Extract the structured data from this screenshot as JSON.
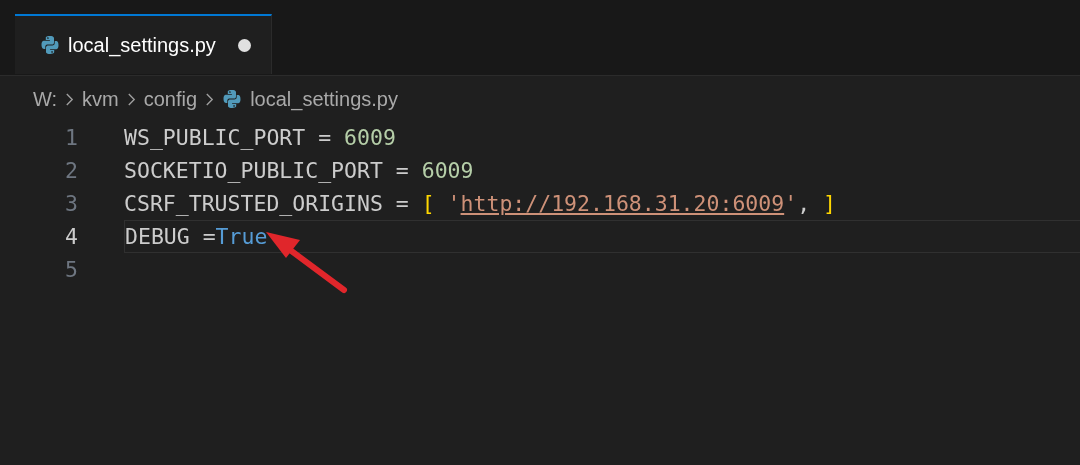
{
  "tabs": [
    {
      "label": "local_settings.py",
      "selected": true,
      "modified": true
    }
  ],
  "breadcrumb": [
    "W:",
    "kvm",
    "config",
    "local_settings.py"
  ],
  "lines": [
    {
      "number": "1",
      "active": false,
      "tokens": [
        {
          "text": "WS_PUBLIC_PORT = ",
          "kind": "plain"
        },
        {
          "text": "6009",
          "kind": "number"
        }
      ]
    },
    {
      "number": "2",
      "active": false,
      "tokens": [
        {
          "text": "SOCKETIO_PUBLIC_PORT = ",
          "kind": "plain"
        },
        {
          "text": "6009",
          "kind": "number"
        }
      ]
    },
    {
      "number": "3",
      "active": false,
      "tokens": [
        {
          "text": "CSRF_TRUSTED_ORIGINS = ",
          "kind": "plain"
        },
        {
          "text": "[",
          "kind": "bracket"
        },
        {
          "text": " '",
          "kind": "string"
        },
        {
          "text": "http://192.168.31.20:6009",
          "kind": "link"
        },
        {
          "text": "'",
          "kind": "string"
        },
        {
          "text": ", ",
          "kind": "plain"
        },
        {
          "text": "]",
          "kind": "bracket"
        }
      ]
    },
    {
      "number": "4",
      "active": true,
      "tokens": [
        {
          "text": "DEBUG =",
          "kind": "plain"
        },
        {
          "text": "True",
          "kind": "keyword"
        }
      ]
    },
    {
      "number": "5",
      "active": false
    }
  ],
  "annotation": {
    "kind": "arrow",
    "color": "#e0262b"
  }
}
